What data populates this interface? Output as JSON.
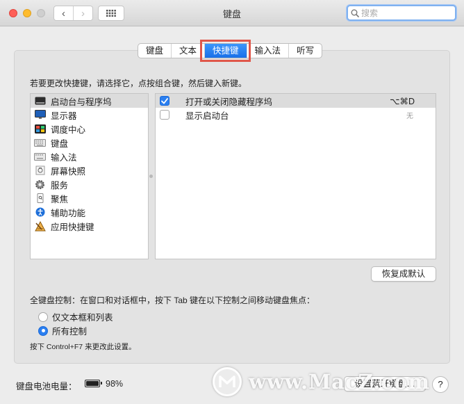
{
  "window": {
    "title": "键盘",
    "search_placeholder": "搜索"
  },
  "nav": {
    "back": "‹",
    "forward": "›"
  },
  "tabs": [
    {
      "label": "键盘"
    },
    {
      "label": "文本"
    },
    {
      "label": "快捷键",
      "active": true
    },
    {
      "label": "输入法"
    },
    {
      "label": "听写"
    }
  ],
  "instruction": "若要更改快捷键，请选择它，点按组合键，然后键入新键。",
  "categories": [
    {
      "label": "启动台与程序坞",
      "icon": "launchpad-dock-icon",
      "selected": true
    },
    {
      "label": "显示器",
      "icon": "display-icon"
    },
    {
      "label": "调度中心",
      "icon": "mission-control-icon"
    },
    {
      "label": "键盘",
      "icon": "keyboard-icon"
    },
    {
      "label": "输入法",
      "icon": "input-source-icon"
    },
    {
      "label": "屏幕快照",
      "icon": "screenshot-icon"
    },
    {
      "label": "服务",
      "icon": "gear-icon"
    },
    {
      "label": "聚焦",
      "icon": "spotlight-icon"
    },
    {
      "label": "辅助功能",
      "icon": "accessibility-icon"
    },
    {
      "label": "应用快捷键",
      "icon": "app-shortcuts-icon"
    }
  ],
  "shortcuts": [
    {
      "label": "打开或关闭隐藏程序坞",
      "checked": true,
      "keys": "⌥⌘D",
      "selected": true
    },
    {
      "label": "显示启动台",
      "checked": false,
      "keys": "无",
      "selected": false
    }
  ],
  "restore_button": "恢复成默认",
  "full_keyboard_access": {
    "label": "全键盘控制：在窗口和对话框中，按下 Tab 键在以下控制之间移动键盘焦点：",
    "options": [
      {
        "label": "仅文本框和列表",
        "selected": false
      },
      {
        "label": "所有控制",
        "selected": true
      }
    ],
    "hint": "按下 Control+F7 来更改此设置。"
  },
  "footer": {
    "battery_label": "键盘电池电量：",
    "battery_percent": "98%",
    "battery_level": 0.98,
    "bluetooth_button": "设置蓝牙键盘…",
    "help": "?"
  },
  "watermark": "www.MacZ.com",
  "colors": {
    "accent": "#2b7ff0",
    "highlight_box": "#e0574a",
    "close": "#fe5f57",
    "minimize": "#febc2e"
  }
}
